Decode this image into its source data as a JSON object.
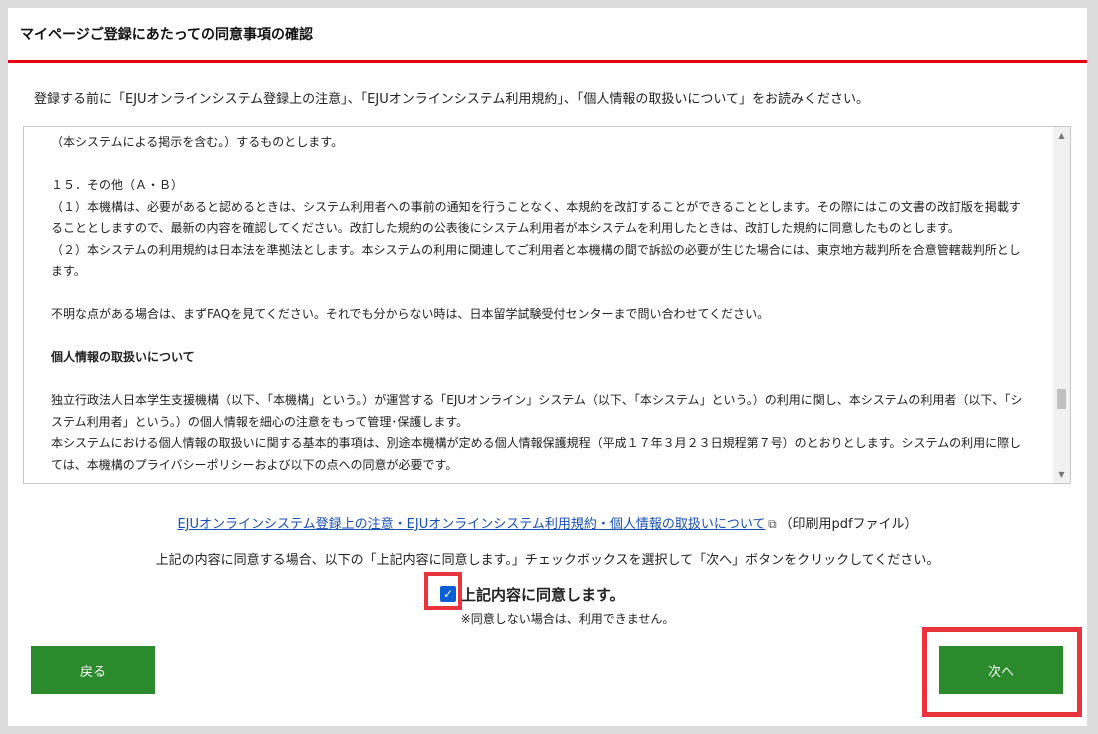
{
  "header": {
    "title": "マイページご登録にあたっての同意事項の確認"
  },
  "intro": "登録する前に「EJUオンラインシステム登録上の注意」、「EJUオンラインシステム利用規約」、「個人情報の取扱いについて」をお読みください。",
  "terms": {
    "lines": [
      "（本システムによる掲示を含む。）するものとします。",
      "",
      "１５．その他（Ａ・Ｂ）",
      "（１）本機構は、必要があると認めるときは、システム利用者への事前の通知を行うことなく、本規約を改訂することができることとします。その際にはこの文書の改訂版を掲載することとしますので、最新の内容を確認してください。改訂した規約の公表後にシステム利用者が本システムを利用したときは、改訂した規約に同意したものとします。",
      "（２）本システムの利用規約は日本法を準拠法とします。本システムの利用に関連してご利用者と本機構の間で訴訟の必要が生じた場合には、東京地方裁判所を合意管轄裁判所とします。",
      "",
      "不明な点がある場合は、まずFAQを見てください。それでも分からない時は、日本留学試験受付センターまで問い合わせてください。",
      "",
      "個人情報の取扱いについて",
      "",
      "独立行政法人日本学生支援機構（以下、「本機構」という。）が運営する「EJUオンライン」システム（以下、「本システム」という。）の利用に関し、本システムの利用者（以下、「システム利用者」という。）の個人情報を細心の注意をもって管理･保護します。",
      "本システムにおける個人情報の取扱いに関する基本的事項は、別途本機構が定める個人情報保護規程（平成１７年３月２３日規程第７号）のとおりとします。システムの利用に際しては、本機構のプライバシーポリシーおよび以下の点への同意が必要です。"
    ]
  },
  "pdf": {
    "link_text": "EJUオンラインシステム登録上の注意・EJUオンラインシステム利用規約・個人情報の取扱いについて",
    "note": "（印刷用pdfファイル）"
  },
  "instruction": "上記の内容に同意する場合、以下の「上記内容に同意します。」チェックボックスを選択して「次へ」ボタンをクリックしてください。",
  "agree": {
    "label": "上記内容に同意します。",
    "checked": true,
    "note": "※同意しない場合は、利用できません。"
  },
  "buttons": {
    "back": "戻る",
    "next": "次へ"
  },
  "colors": {
    "accent_red": "#e60012",
    "button_green": "#2b8a2b",
    "link_blue": "#1a4fb4",
    "highlight_red": "#e8343c"
  }
}
